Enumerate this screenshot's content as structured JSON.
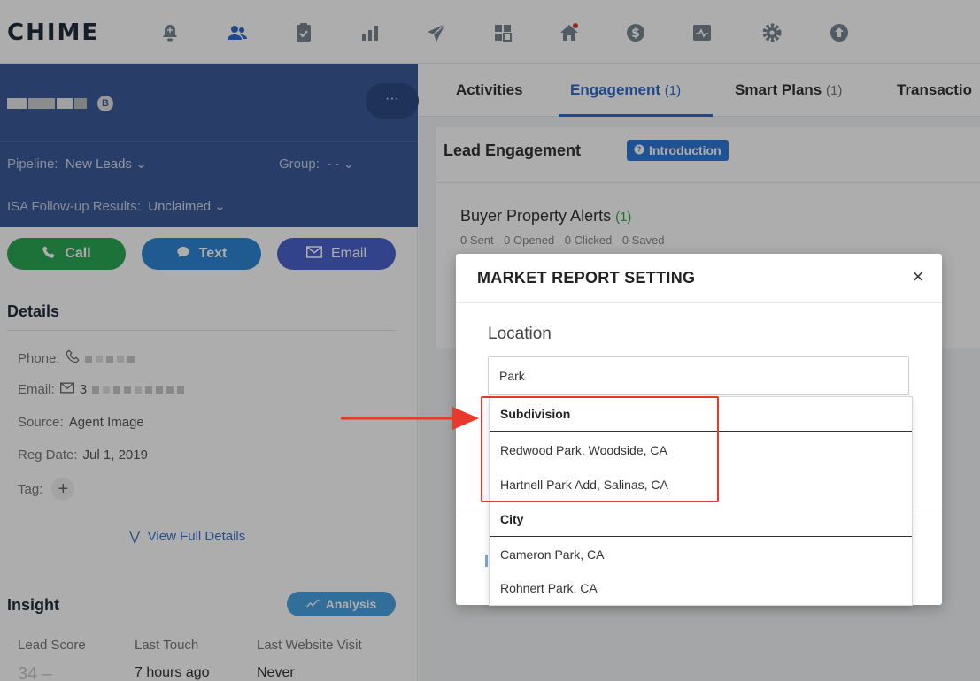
{
  "app": {
    "logo": "CHIME"
  },
  "nav": {
    "icons": [
      "bell-icon",
      "people-icon",
      "clipboard-icon",
      "bar-chart-icon",
      "paper-plane-icon",
      "grid-icon",
      "house-icon",
      "dollar-icon",
      "pulse-icon",
      "gear-icon",
      "upload-icon"
    ],
    "active_icon": "people-icon",
    "active_color": "#2e6cc7",
    "icon_color": "#7a8694"
  },
  "lead": {
    "badge": "B",
    "more_label": "···",
    "pipeline_label": "Pipeline:",
    "pipeline_value": "New Leads",
    "group_label": "Group:",
    "group_value": "- -",
    "isa_label": "ISA Follow-up Results:",
    "isa_value": "Unclaimed",
    "header_color": "#3c5b99"
  },
  "actions": {
    "call": "Call",
    "text": "Text",
    "email": "Email",
    "call_color": "#2ca855",
    "text_color": "#2f86d6",
    "email_color": "#4a63cf"
  },
  "details": {
    "title": "Details",
    "phone_label": "Phone:",
    "email_label": "Email:",
    "email_prefix": "3",
    "source_label": "Source:",
    "source_value": "Agent Image",
    "reg_label": "Reg Date:",
    "reg_value": "Jul 1, 2019",
    "tag_label": "Tag:",
    "tag_add": "+",
    "view_full": "View Full Details"
  },
  "insight": {
    "title": "Insight",
    "analysis": "Analysis",
    "lead_score_label": "Lead Score",
    "lead_score_value": "34",
    "lead_score_trend": "–",
    "last_touch_label": "Last Touch",
    "last_touch_value": "7 hours ago",
    "last_visit_label": "Last Website Visit",
    "last_visit_value": "Never"
  },
  "tabs": [
    {
      "label": "Activities",
      "count": ""
    },
    {
      "label": "Engagement",
      "count": "(1)"
    },
    {
      "label": "Smart Plans",
      "count": "(1)"
    },
    {
      "label": "Transactio",
      "count": ""
    }
  ],
  "engagement": {
    "title": "Lead Engagement",
    "intro_badge": "Introduction",
    "buyer_alerts_title": "Buyer Property Alerts",
    "buyer_alerts_count": "(1)",
    "buyer_alerts_stats": "0 Sent - 0 Opened - 0 Clicked - 0 Saved"
  },
  "modal": {
    "title": "MARKET REPORT SETTING",
    "close": "×",
    "location_label": "Location",
    "location_value": "Park"
  },
  "dropdown": {
    "groups": [
      {
        "label": "Subdivision",
        "items": [
          "Redwood Park, Woodside, CA",
          "Hartnell Park Add, Salinas, CA"
        ]
      },
      {
        "label": "City",
        "items": [
          "Cameron Park, CA",
          "Rohnert Park, CA"
        ]
      }
    ]
  },
  "annotation": {
    "color": "#e8392b"
  }
}
